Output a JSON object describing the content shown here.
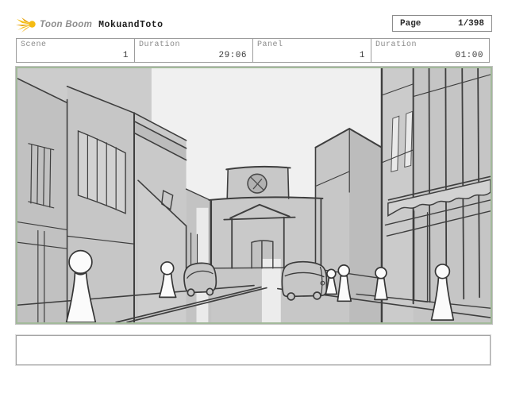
{
  "header": {
    "brand": "Toon Boom",
    "title": "MokuandToto",
    "page_label": "Page",
    "page_value": "1/398"
  },
  "info_row": {
    "cells": [
      {
        "label": "Scene",
        "value": "1"
      },
      {
        "label": "Duration",
        "value": "29:06"
      },
      {
        "label": "Panel",
        "value": "1"
      },
      {
        "label": "Duration",
        "value": "01:00"
      }
    ]
  },
  "panel": {
    "description": "hand-drawn storyboard sketch of a city street with buildings, a central building with pediment and round emblem, two cars and six pawn-shaped pedestrians"
  },
  "caption": {
    "text": ""
  },
  "icons": {
    "logo": "toonboom-starburst-icon"
  },
  "colors": {
    "brand_yellow": "#f2b41b",
    "frame_green": "#a3ba9b",
    "sketch_line": "#3e3e3e",
    "sketch_bg": "#c7c7c7",
    "sky": "#f0f0f0"
  }
}
